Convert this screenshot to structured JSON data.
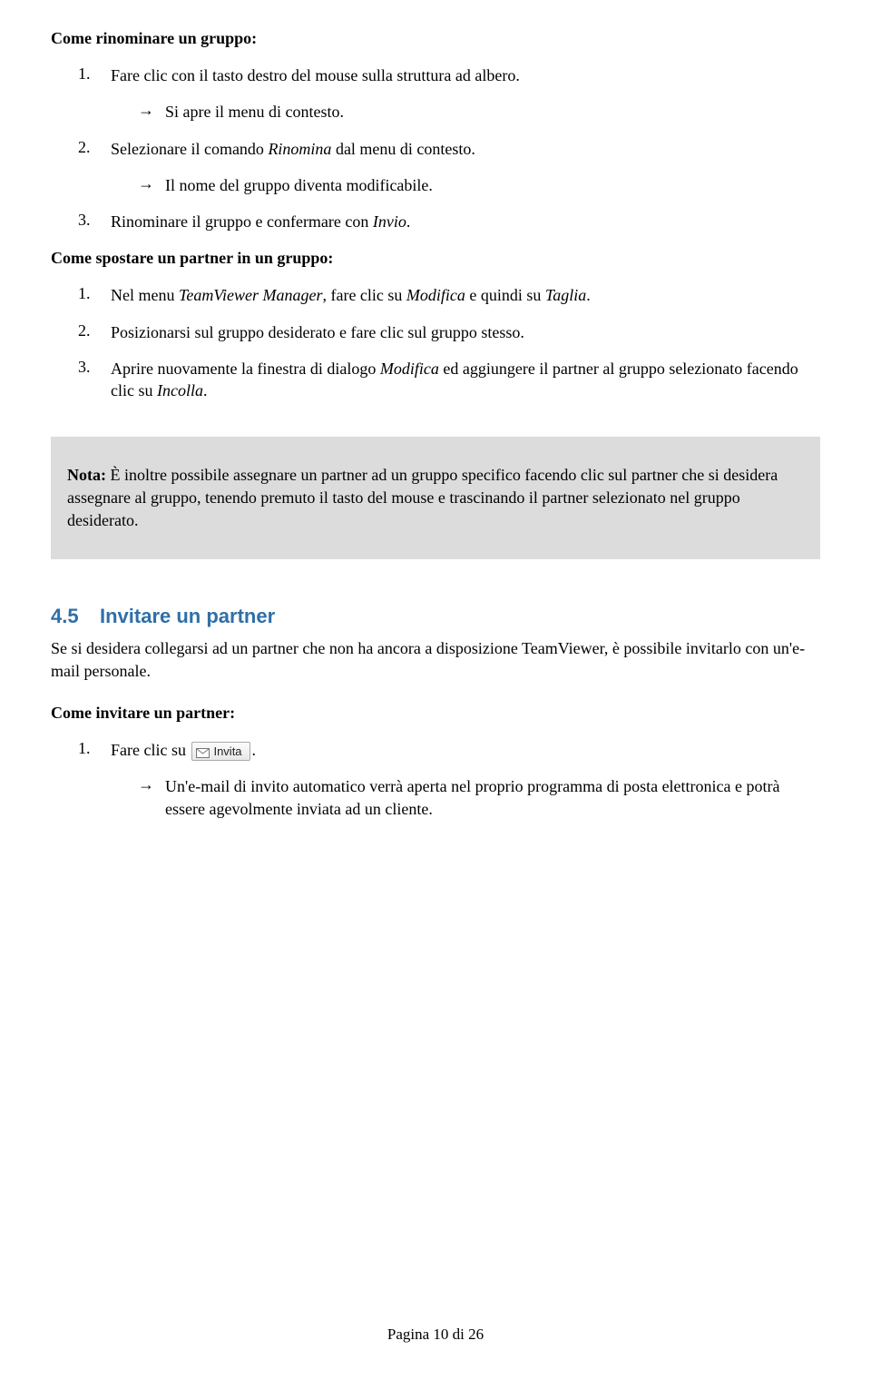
{
  "s1": {
    "heading": "Come rinominare un gruppo:",
    "step1_num": "1.",
    "step1_text": "Fare clic con il tasto destro del mouse sulla struttura ad albero.",
    "arrow1_text": "Si apre il menu di contesto.",
    "step2_num": "2.",
    "step2_pre": "Selezionare il comando ",
    "step2_it": "Rinomina",
    "step2_post": " dal menu di contesto.",
    "arrow2_text": "Il nome del gruppo diventa modificabile.",
    "step3_num": "3.",
    "step3_pre": "Rinominare il gruppo e confermare con ",
    "step3_it": "Invio",
    "step3_post": "."
  },
  "s2": {
    "heading": "Come spostare un partner in un gruppo:",
    "step1_num": "1.",
    "step1_a": "Nel menu ",
    "step1_it1": "TeamViewer Manager",
    "step1_b": ", fare clic su ",
    "step1_it2": "Modifica",
    "step1_c": " e quindi su ",
    "step1_it3": "Taglia",
    "step1_d": ".",
    "step2_num": "2.",
    "step2_text": "Posizionarsi sul gruppo desiderato e fare clic sul gruppo stesso.",
    "step3_num": "3.",
    "step3_a": "Aprire nuovamente la finestra di dialogo ",
    "step3_it1": "Modifica",
    "step3_b": " ed aggiungere il partner al gruppo selezionato facendo clic su ",
    "step3_it2": "Incolla",
    "step3_c": "."
  },
  "note": {
    "label": "Nota:",
    "text": " È inoltre possibile assegnare un partner ad un gruppo specifico facendo clic sul partner che si desidera assegnare al gruppo, tenendo premuto il tasto del mouse e trascinando il partner selezionato nel gruppo desiderato."
  },
  "sec45": {
    "number": "4.5",
    "title": "Invitare un partner",
    "p1": "Se si desidera collegarsi ad un partner che non ha ancora a disposizione TeamViewer, è possibile invitarlo con un'e-mail personale."
  },
  "s3": {
    "heading": "Come invitare un partner:",
    "step1_num": "1.",
    "step1_text": "Fare clic su ",
    "btn_label": "Invita",
    "step1_post": ".",
    "arrow1_text": "Un'e-mail di invito automatico verrà aperta nel proprio programma di posta elettronica e potrà essere agevolmente inviata ad un cliente."
  },
  "footer": "Pagina 10 di 26",
  "glyphs": {
    "arrow": "→"
  }
}
